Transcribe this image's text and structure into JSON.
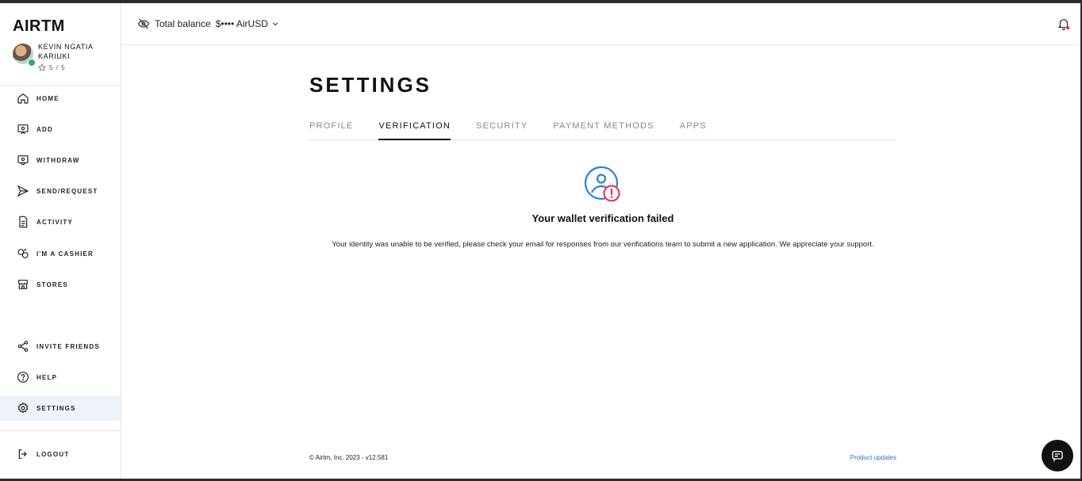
{
  "brand": {
    "logo_text": "AIRTM"
  },
  "user": {
    "name": "KEVIN NGATIA KARIUKI",
    "rating": "5 / 5"
  },
  "sidebar": {
    "items": [
      {
        "label": "HOME",
        "icon": "home-icon"
      },
      {
        "label": "ADD",
        "icon": "add-funds-icon"
      },
      {
        "label": "WITHDRAW",
        "icon": "withdraw-icon"
      },
      {
        "label": "SEND/REQUEST",
        "icon": "send-icon"
      },
      {
        "label": "ACTIVITY",
        "icon": "activity-icon"
      },
      {
        "label": "I'M A CASHIER",
        "icon": "cashier-icon"
      },
      {
        "label": "STORES",
        "icon": "store-icon"
      }
    ],
    "secondary": [
      {
        "label": "INVITE FRIENDS",
        "icon": "share-icon"
      },
      {
        "label": "HELP",
        "icon": "help-icon"
      },
      {
        "label": "SETTINGS",
        "icon": "gear-icon"
      }
    ],
    "logout_label": "LOGOUT",
    "active_item": "SETTINGS"
  },
  "topbar": {
    "balance_label": "Total balance",
    "balance_value": "$•••• AirUSD"
  },
  "page": {
    "title": "SETTINGS",
    "tabs": [
      "PROFILE",
      "VERIFICATION",
      "SECURITY",
      "PAYMENT METHODS",
      "APPS"
    ],
    "active_tab": "VERIFICATION"
  },
  "verification": {
    "title": "Your wallet verification failed",
    "description": "Your identity was unable to be verified, please check your email for responses from our verifications team to submit a new application. We appreciate your support."
  },
  "footer": {
    "copyright": "© Airtm, Inc. 2023 - v12.581",
    "product_updates": "Product updates"
  },
  "colors": {
    "accent": "#2b6fc7",
    "error": "#e8395a",
    "active_nav_bg": "#eef3fb"
  }
}
